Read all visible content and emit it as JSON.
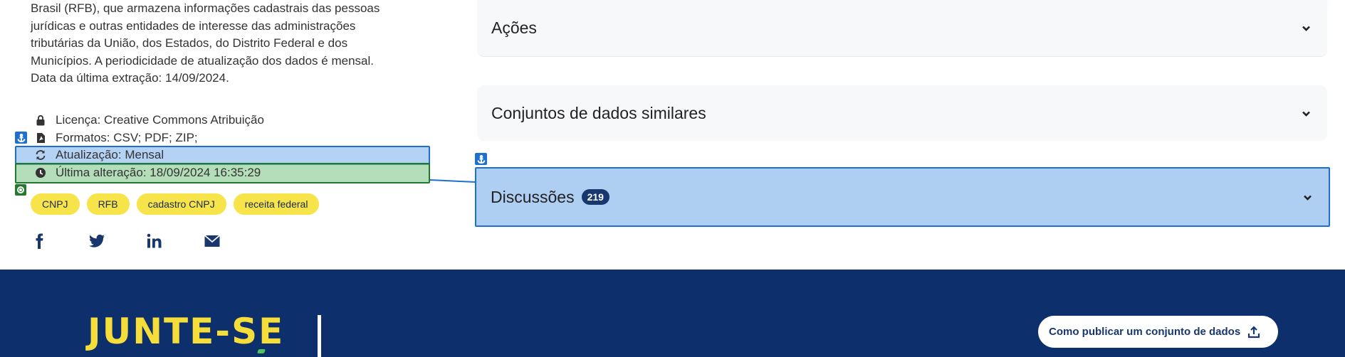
{
  "description": {
    "lines": [
      "Brasil (RFB), que armazena informações cadastrais das pessoas",
      "jurídicas e outras entidades de interesse das administrações",
      "tributárias da União, dos Estados, do Distrito Federal e dos",
      "Municípios. A periodicidade de atualização dos dados é mensal.",
      "Data da última extração: 14/09/2024."
    ]
  },
  "meta": {
    "license": "Licença: Creative Commons Atribuição",
    "formats": "Formatos: CSV; PDF; ZIP;",
    "update": "Atualização: Mensal",
    "last_change": "Última alteração: 18/09/2024 16:35:29"
  },
  "tags": [
    "CNPJ",
    "RFB",
    "cadastro CNPJ",
    "receita federal"
  ],
  "social": [
    {
      "name": "facebook-icon"
    },
    {
      "name": "twitter-icon"
    },
    {
      "name": "linkedin-icon"
    },
    {
      "name": "email-icon"
    }
  ],
  "accordions": {
    "acoes": "Ações",
    "similares": "Conjuntos de dados similares",
    "discussoes": "Discussões",
    "discussoes_count": "219"
  },
  "footer": {
    "join_title": "JUNTE-SE",
    "publish_button": "Como publicar um conjunto de dados"
  },
  "colors": {
    "footer_bg": "#0d2f6b",
    "tag_bg": "#f7e34a",
    "accent_yellow": "#f5dd3a",
    "selection_blue": "#1e6fd0",
    "selection_green": "#237a2e"
  }
}
